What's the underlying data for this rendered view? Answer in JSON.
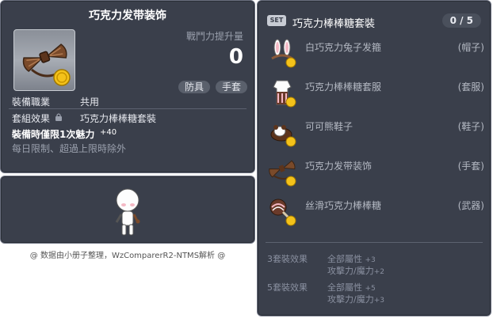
{
  "item_code": "01082581",
  "item": {
    "name": "巧克力发带装饰",
    "power_label": "戰鬥力提升量",
    "power_value": "0",
    "tag_type": "防具",
    "tag_slot": "手套",
    "job_label": "裝備職業",
    "job_value": "共用",
    "set_label": "套組效果",
    "set_value": "巧克力棒棒糖套裝",
    "equip_limit_label": "裝備時僅限1次魅力",
    "equip_limit_value": "+40",
    "daily_limit": "每日限制、超過上限時除外"
  },
  "footer": "@ 数据由小册子整理，WzComparerR2-NTMS解析 @",
  "set": {
    "badge": "SET",
    "title": "巧克力棒棒糖套裝",
    "count": "0 / 5",
    "items": [
      {
        "name": "白巧克力兔子发箍",
        "slot": "(帽子)",
        "icon": "bunny-headband-icon"
      },
      {
        "name": "巧克力棒棒糖套服",
        "slot": "(套服)",
        "icon": "overall-icon"
      },
      {
        "name": "可可熊鞋子",
        "slot": "(鞋子)",
        "icon": "bear-shoes-icon"
      },
      {
        "name": "巧克力发带装饰",
        "slot": "(手套)",
        "icon": "ribbon-icon"
      },
      {
        "name": "丝滑巧克力棒棒糖",
        "slot": "(武器)",
        "icon": "lollipop-icon"
      }
    ],
    "effects": [
      {
        "label": "3套裝效果",
        "lines": [
          {
            "stat": "全部屬性",
            "val": "+3"
          },
          {
            "stat": "攻擊力/魔力",
            "val": "+2"
          }
        ]
      },
      {
        "label": "5套裝效果",
        "lines": [
          {
            "stat": "全部屬性",
            "val": "+5"
          },
          {
            "stat": "攻擊力/魔力",
            "val": "+3"
          }
        ]
      }
    ]
  },
  "colors": {
    "panel_bg": "#3a3f4b",
    "panel_border": "#6b7080",
    "muted_text": "#9aa0ad"
  }
}
